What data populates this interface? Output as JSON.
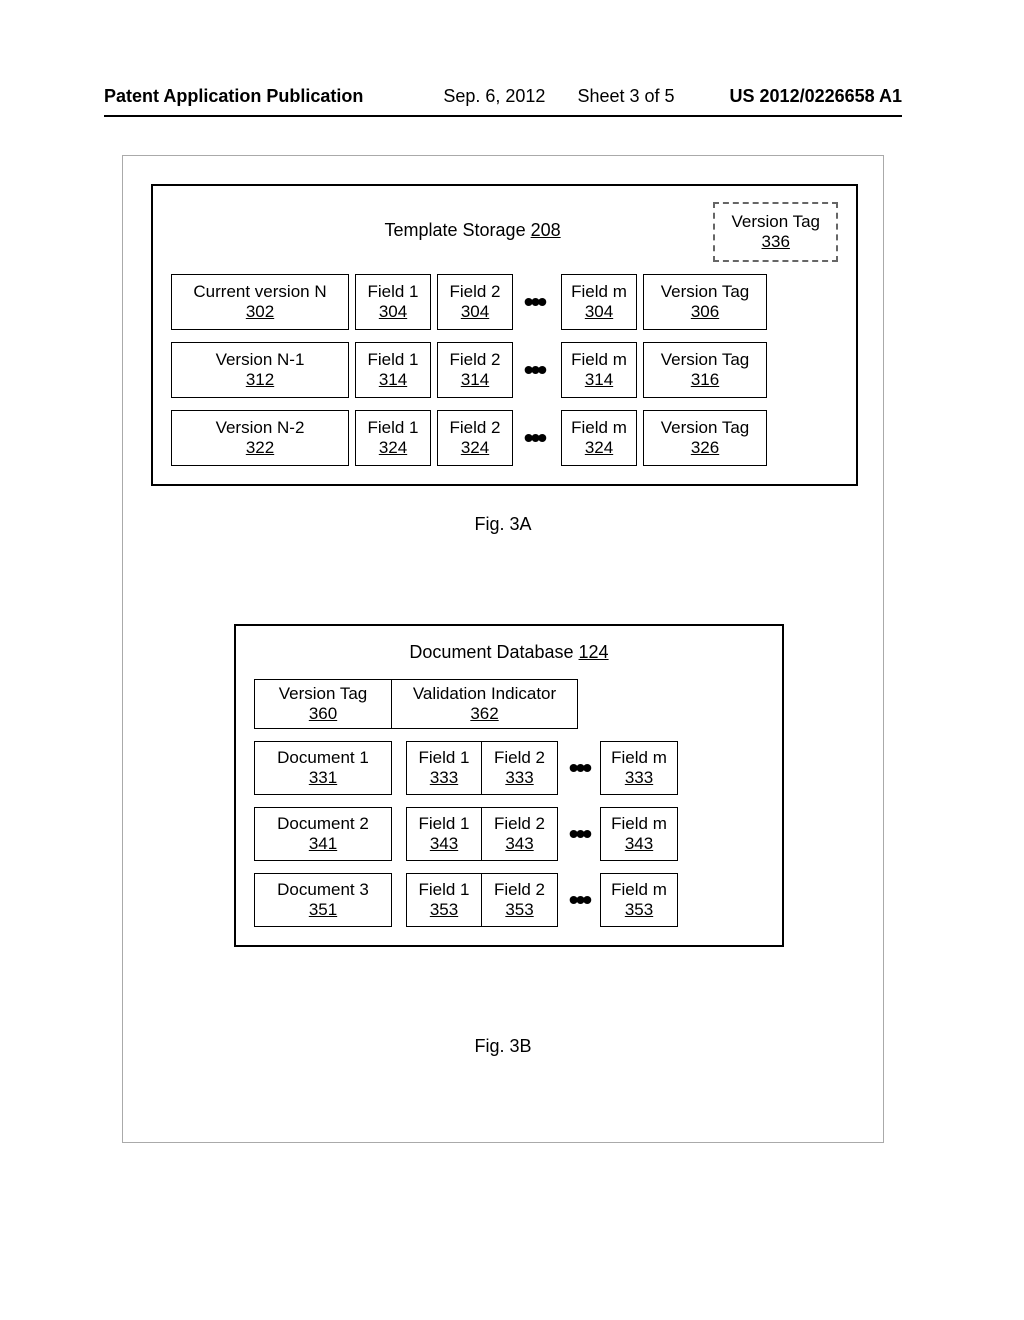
{
  "header": {
    "left": "Patent Application Publication",
    "date": "Sep. 6, 2012",
    "sheet": "Sheet 3 of 5",
    "pubno": "US 2012/0226658 A1"
  },
  "fig3a": {
    "title_label": "Template Storage",
    "title_ref": "208",
    "vtag_box_label": "Version Tag",
    "vtag_box_ref": "336",
    "rows": [
      {
        "version_label": "Current version N",
        "version_ref": "302",
        "f1_label": "Field 1",
        "f1_ref": "304",
        "f2_label": "Field 2",
        "f2_ref": "304",
        "fm_label": "Field m",
        "fm_ref": "304",
        "tag_label": "Version Tag",
        "tag_ref": "306"
      },
      {
        "version_label": "Version N-1",
        "version_ref": "312",
        "f1_label": "Field 1",
        "f1_ref": "314",
        "f2_label": "Field 2",
        "f2_ref": "314",
        "fm_label": "Field m",
        "fm_ref": "314",
        "tag_label": "Version Tag",
        "tag_ref": "316"
      },
      {
        "version_label": "Version N-2",
        "version_ref": "322",
        "f1_label": "Field 1",
        "f1_ref": "324",
        "f2_label": "Field 2",
        "f2_ref": "324",
        "fm_label": "Field m",
        "fm_ref": "324",
        "tag_label": "Version Tag",
        "tag_ref": "326"
      }
    ],
    "caption": "Fig. 3A"
  },
  "fig3b": {
    "title_label": "Document Database",
    "title_ref": "124",
    "hdr_vtag_label": "Version Tag",
    "hdr_vtag_ref": "360",
    "hdr_valind_label": "Validation Indicator",
    "hdr_valind_ref": "362",
    "rows": [
      {
        "doc_label": "Document 1",
        "doc_ref": "331",
        "f1_label": "Field 1",
        "f1_ref": "333",
        "f2_label": "Field 2",
        "f2_ref": "333",
        "fm_label": "Field m",
        "fm_ref": "333"
      },
      {
        "doc_label": "Document 2",
        "doc_ref": "341",
        "f1_label": "Field 1",
        "f1_ref": "343",
        "f2_label": "Field 2",
        "f2_ref": "343",
        "fm_label": "Field m",
        "fm_ref": "343"
      },
      {
        "doc_label": "Document 3",
        "doc_ref": "351",
        "f1_label": "Field 1",
        "f1_ref": "353",
        "f2_label": "Field 2",
        "f2_ref": "353",
        "fm_label": "Field m",
        "fm_ref": "353"
      }
    ],
    "caption": "Fig. 3B"
  }
}
